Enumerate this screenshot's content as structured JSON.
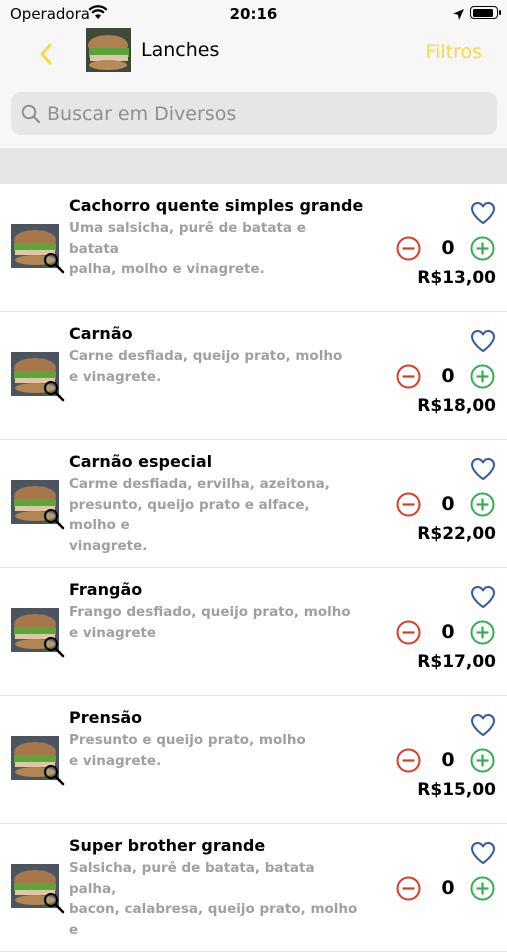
{
  "status_bar": {
    "carrier": "Operadora",
    "time": "20:16",
    "battery_level": 0.9
  },
  "nav": {
    "title": "Lanches",
    "filters_label": "Filtros"
  },
  "search": {
    "placeholder": "Buscar em Diversos",
    "value": ""
  },
  "colors": {
    "accent": "#f9d648",
    "minus": "#d93a2b",
    "plus": "#2fb04a",
    "heart": "#2e5aa7",
    "desc": "#a0a0a0"
  },
  "items": [
    {
      "name": "Cachorro quente simples grande",
      "desc_lines": [
        "Uma salsicha, purê de batata e batata",
        "palha, molho e vinagrete."
      ],
      "qty": "0",
      "price": "R$13,00"
    },
    {
      "name": "Carnão",
      "desc_lines": [
        "Carne desfiada, queijo prato, molho",
        "e vinagrete."
      ],
      "qty": "0",
      "price": "R$18,00"
    },
    {
      "name": "Carnão especial",
      "desc_lines": [
        "Carme desfiada, ervilha, azeitona,",
        "presunto, queijo prato e alface, molho e",
        "vinagrete."
      ],
      "qty": "0",
      "price": "R$22,00"
    },
    {
      "name": "Frangão",
      "desc_lines": [
        "Frango desfiado, queijo prato, molho",
        "e vinagrete"
      ],
      "qty": "0",
      "price": "R$17,00"
    },
    {
      "name": "Prensão",
      "desc_lines": [
        "Presunto e queijo prato, molho",
        "e vinagrete."
      ],
      "qty": "0",
      "price": "R$15,00"
    },
    {
      "name": "Super brother grande",
      "desc_lines": [
        "Salsicha, purê de batata, batata palha,",
        "bacon, calabresa, queijo prato, molho e"
      ],
      "qty": "0",
      "price": ""
    }
  ]
}
